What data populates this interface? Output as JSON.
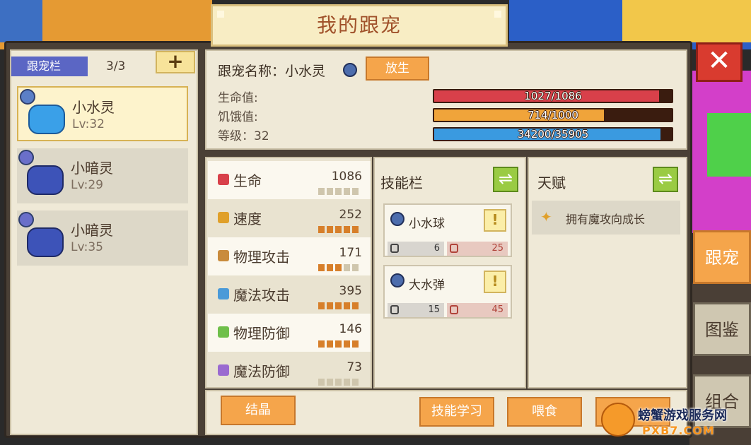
{
  "window": {
    "title": "我的跟宠"
  },
  "pet_list": {
    "tag_label": "跟宠栏",
    "count": "3/3",
    "add_label": "+",
    "pets": [
      {
        "name": "小水灵",
        "level": "Lv:32",
        "element_icon": "water-element-icon",
        "selected": true
      },
      {
        "name": "小暗灵",
        "level": "Lv:29",
        "element_icon": "dark-element-icon",
        "selected": false
      },
      {
        "name": "小暗灵",
        "level": "Lv:35",
        "element_icon": "dark-element-icon",
        "selected": false
      }
    ]
  },
  "info": {
    "name_label": "跟宠名称：小水灵",
    "release_label": "放生",
    "hp_label": "生命值:",
    "hunger_label": "饥饿值:",
    "level_label": "等级：32",
    "hp_text": "1027/1086",
    "hp_fraction": 0.946,
    "hunger_text": "714/1000",
    "hunger_fraction": 0.714,
    "exp_text": "34200/35905",
    "exp_fraction": 0.952
  },
  "stats": [
    {
      "name": "生命",
      "value": "1086",
      "pips": 0,
      "icon": "heart-icon",
      "color": "#d8404a"
    },
    {
      "name": "速度",
      "value": "252",
      "pips": 5,
      "icon": "boot-icon",
      "color": "#e0a02a"
    },
    {
      "name": "物理攻击",
      "value": "171",
      "pips": 3,
      "icon": "fist-icon",
      "color": "#c98b3c"
    },
    {
      "name": "魔法攻击",
      "value": "395",
      "pips": 5,
      "icon": "magic-icon",
      "color": "#4a9ad8"
    },
    {
      "name": "物理防御",
      "value": "146",
      "pips": 5,
      "icon": "shield-icon",
      "color": "#6fbf4a"
    },
    {
      "name": "魔法防御",
      "value": "73",
      "pips": 0,
      "icon": "flower-icon",
      "color": "#9a6ad0"
    }
  ],
  "skills": {
    "title": "技能栏",
    "swap_label": "⇌",
    "items": [
      {
        "name": "小水球",
        "cooldown": "6",
        "cost": "25"
      },
      {
        "name": "大水弹",
        "cooldown": "15",
        "cost": "45"
      }
    ],
    "info_label": "!"
  },
  "talent": {
    "title": "天赋",
    "swap_label": "⇌",
    "text": "拥有魔攻向成长"
  },
  "actions": {
    "crystal": "结晶",
    "learn_skill": "技能学习",
    "feed": "喂食"
  },
  "side_tabs": [
    "跟宠",
    "图鉴",
    "组合"
  ],
  "close_label": "✕",
  "watermark": {
    "title": "螃蟹游戏服务网",
    "url": "PXB7.COM"
  },
  "colors": {
    "hp": "#d8404a",
    "hunger": "#f0a43a",
    "exp": "#3a9ae0",
    "accent_orange": "#f5a54b"
  }
}
